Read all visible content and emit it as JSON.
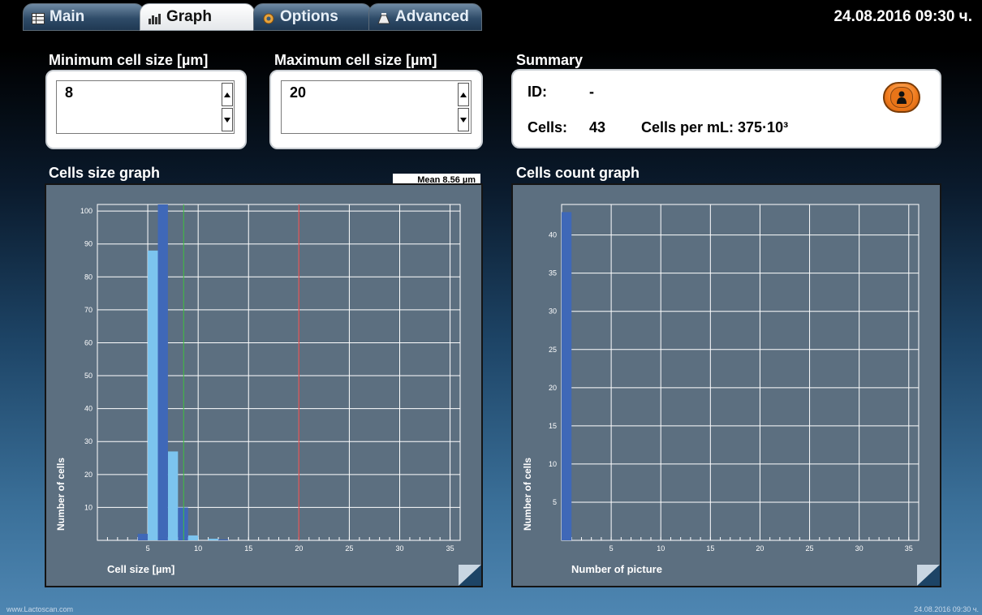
{
  "tabs": [
    {
      "label": "Main",
      "icon": "table-icon",
      "active": false
    },
    {
      "label": "Graph",
      "icon": "bar-chart-icon",
      "active": true
    },
    {
      "label": "Options",
      "icon": "gear-icon",
      "active": false
    },
    {
      "label": "Advanced",
      "icon": "flask-icon",
      "active": false
    }
  ],
  "datetime": "24.08.2016 09:30 ч.",
  "min_cell": {
    "label": "Minimum cell size [µm]",
    "value": "8"
  },
  "max_cell": {
    "label": "Maximum cell size [µm]",
    "value": "20"
  },
  "summary": {
    "title": "Summary",
    "id_label": "ID:",
    "id_value": "-",
    "cells_label": "Cells:",
    "cells_value": "43",
    "per_ml_label": "Cells per mL: 375·10³"
  },
  "size_graph": {
    "title": "Cells size graph",
    "mean_label": "Mean 8.56 µm"
  },
  "count_graph": {
    "title": "Cells count graph"
  },
  "chart_data": [
    {
      "type": "bar",
      "title": "Cells size graph",
      "xlabel": "Cell size [µm]",
      "ylabel": "Number of cells",
      "xlim": [
        0,
        36
      ],
      "ylim": [
        0,
        102
      ],
      "x_ticks": [
        5,
        10,
        15,
        20,
        25,
        30,
        35
      ],
      "y_ticks": [
        10,
        20,
        30,
        40,
        50,
        60,
        70,
        80,
        90,
        100
      ],
      "series": [
        {
          "color": "#7cc4ee",
          "bars": [
            {
              "x": 5.5,
              "y": 88
            },
            {
              "x": 7.5,
              "y": 27
            },
            {
              "x": 9.5,
              "y": 1.5
            },
            {
              "x": 11.5,
              "y": 0.5
            }
          ]
        },
        {
          "color": "#3f68b8",
          "bars": [
            {
              "x": 4.5,
              "y": 2
            },
            {
              "x": 6.5,
              "y": 102
            },
            {
              "x": 8.5,
              "y": 10
            },
            {
              "x": 12.5,
              "y": 0.3
            }
          ]
        }
      ],
      "mean_line": {
        "x": 8.56,
        "color": "#3fc03f"
      },
      "max_line": {
        "x": 20,
        "color": "#e03030"
      },
      "mean_text": "Mean 8.56 µm"
    },
    {
      "type": "bar",
      "title": "Cells count graph",
      "xlabel": "Number of picture",
      "ylabel": "Number of cells",
      "xlim": [
        0,
        36
      ],
      "ylim": [
        0,
        44
      ],
      "x_ticks": [
        5,
        10,
        15,
        20,
        25,
        30,
        35
      ],
      "y_ticks": [
        5,
        10,
        15,
        20,
        25,
        30,
        35,
        40
      ],
      "series": [
        {
          "color": "#3f68b8",
          "bars": [
            {
              "x": 0.5,
              "y": 43
            }
          ]
        }
      ]
    }
  ],
  "footer": {
    "left": "www.Lactoscan.com",
    "right": "24.08.2016 09:30 ч."
  },
  "colors": {
    "panel": "#5c6f80",
    "grid": "#ffffff",
    "bar_light": "#7cc4ee",
    "bar_dark": "#3f68b8",
    "button_orange": "#f07a1c"
  }
}
